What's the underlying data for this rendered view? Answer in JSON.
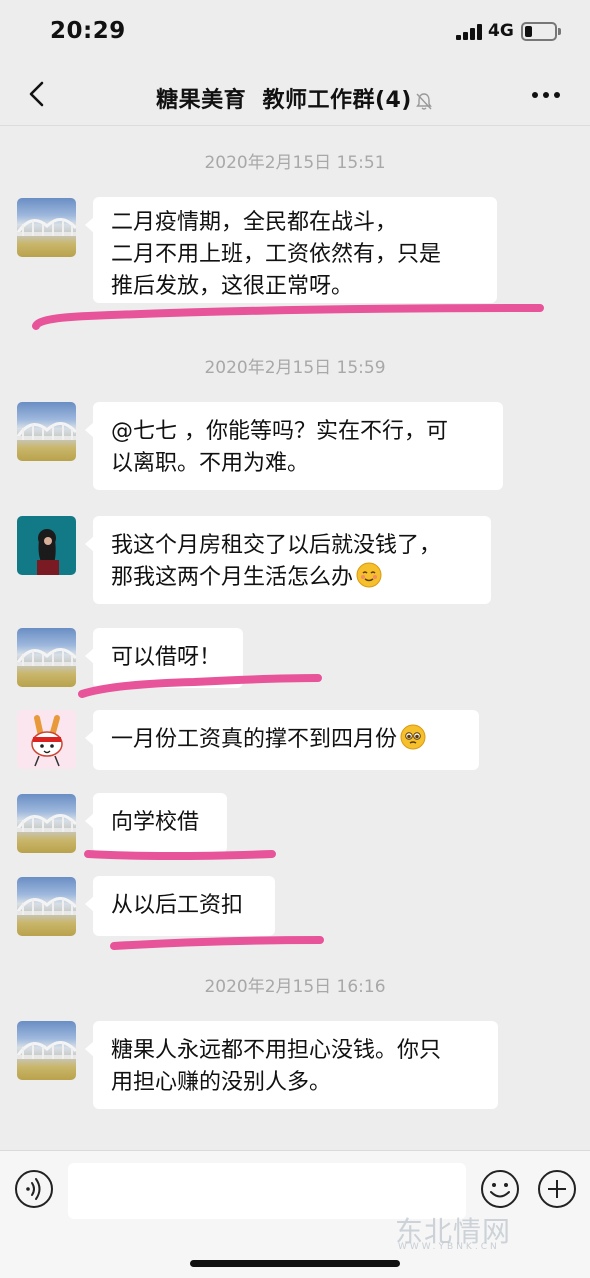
{
  "status_bar": {
    "time": "20:29",
    "network": "4G"
  },
  "nav": {
    "title": "糖果美育  教师工作群(4)"
  },
  "messages": {
    "ts1": "2020年2月15日 15:51",
    "m1_l1": "二月疫情期，全民都在战斗，",
    "m1_l2": "二月不用上班，工资依然有，只是",
    "m1_l3": "推后发放，这很正常呀。",
    "ts2": "2020年2月15日 15:59",
    "m2_l1": "@七七 ，你能等吗？实在不行，可",
    "m2_l2": "以离职。不用为难。",
    "m3_l1": "我这个月房租交了以后就没钱了，",
    "m3_l2": "那我这两个月生活怎么办",
    "m4": "可以借呀！",
    "m5": "一月份工资真的撑不到四月份",
    "m6": "向学校借",
    "m7": "从以后工资扣",
    "ts3": "2020年2月15日 16:16",
    "m8_l1": "糖果人永远都不用担心没钱。你只",
    "m8_l2": "用担心赚的没别人多。"
  },
  "input_bar": {
    "placeholder": ""
  },
  "watermark": {
    "text": "东北情网",
    "sub": "WWW.YBNK.CN"
  },
  "colors": {
    "background": "#ededed",
    "bubble": "#ffffff",
    "highlight": "#e8549a",
    "timestamp": "#a8a8a8"
  },
  "icons": [
    "back-chevron-icon",
    "mute-bell-icon",
    "more-dots-icon",
    "voice-icon",
    "emoji-icon",
    "plus-icon"
  ]
}
